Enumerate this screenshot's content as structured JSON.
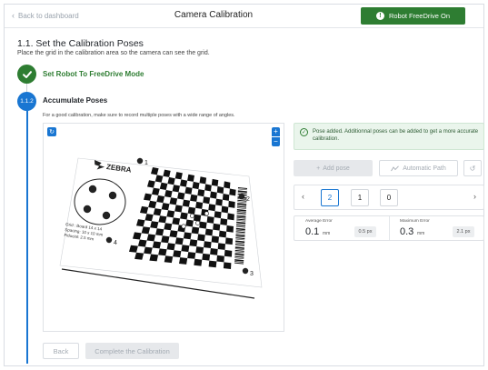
{
  "header": {
    "back_label": "Back to dashboard",
    "title": "Camera Calibration",
    "freedrive_label": "Robot FreeDrive On"
  },
  "section": {
    "title": "1.1. Set the Calibration Poses",
    "subtitle": "Place the grid in the calibration area so the camera can see the grid."
  },
  "steps": [
    {
      "label": "Set Robot To FreeDrive Mode",
      "status": "done"
    },
    {
      "number": "1.1.2",
      "label": "Accumulate Poses",
      "status": "active",
      "description": "For a good calibration, make sure to record multiple poses with a wide range of angles."
    }
  ],
  "board": {
    "brand": "ZEBRA",
    "markers": [
      "1",
      "2",
      "3",
      "4"
    ],
    "spec_lines": [
      "Grid : Board 14 x 14",
      "Spacing: 10 x 10 mm",
      "Fiducial: 2.5 mm"
    ]
  },
  "notice": {
    "text": "Pose added. Additionnal poses can be added to get a more accurate calibration."
  },
  "actions": {
    "add_pose": "Add pose",
    "automatic_path": "Automatic Path"
  },
  "pager": {
    "pages": [
      "2",
      "1",
      "0"
    ],
    "active_index": 0
  },
  "errors": {
    "average": {
      "label": "Average Error",
      "value": "0.1",
      "unit": "mm",
      "px": "0.5 px"
    },
    "maximum": {
      "label": "Maximum Error",
      "value": "0.3",
      "unit": "mm",
      "px": "2.1 px"
    }
  },
  "footer": {
    "back": "Back",
    "complete": "Complete the Calibration"
  },
  "colors": {
    "primary": "#1976d2",
    "success": "#2e7d32",
    "notice_bg": "#eaf5ec",
    "disabled_bg": "#e6e8eb"
  }
}
